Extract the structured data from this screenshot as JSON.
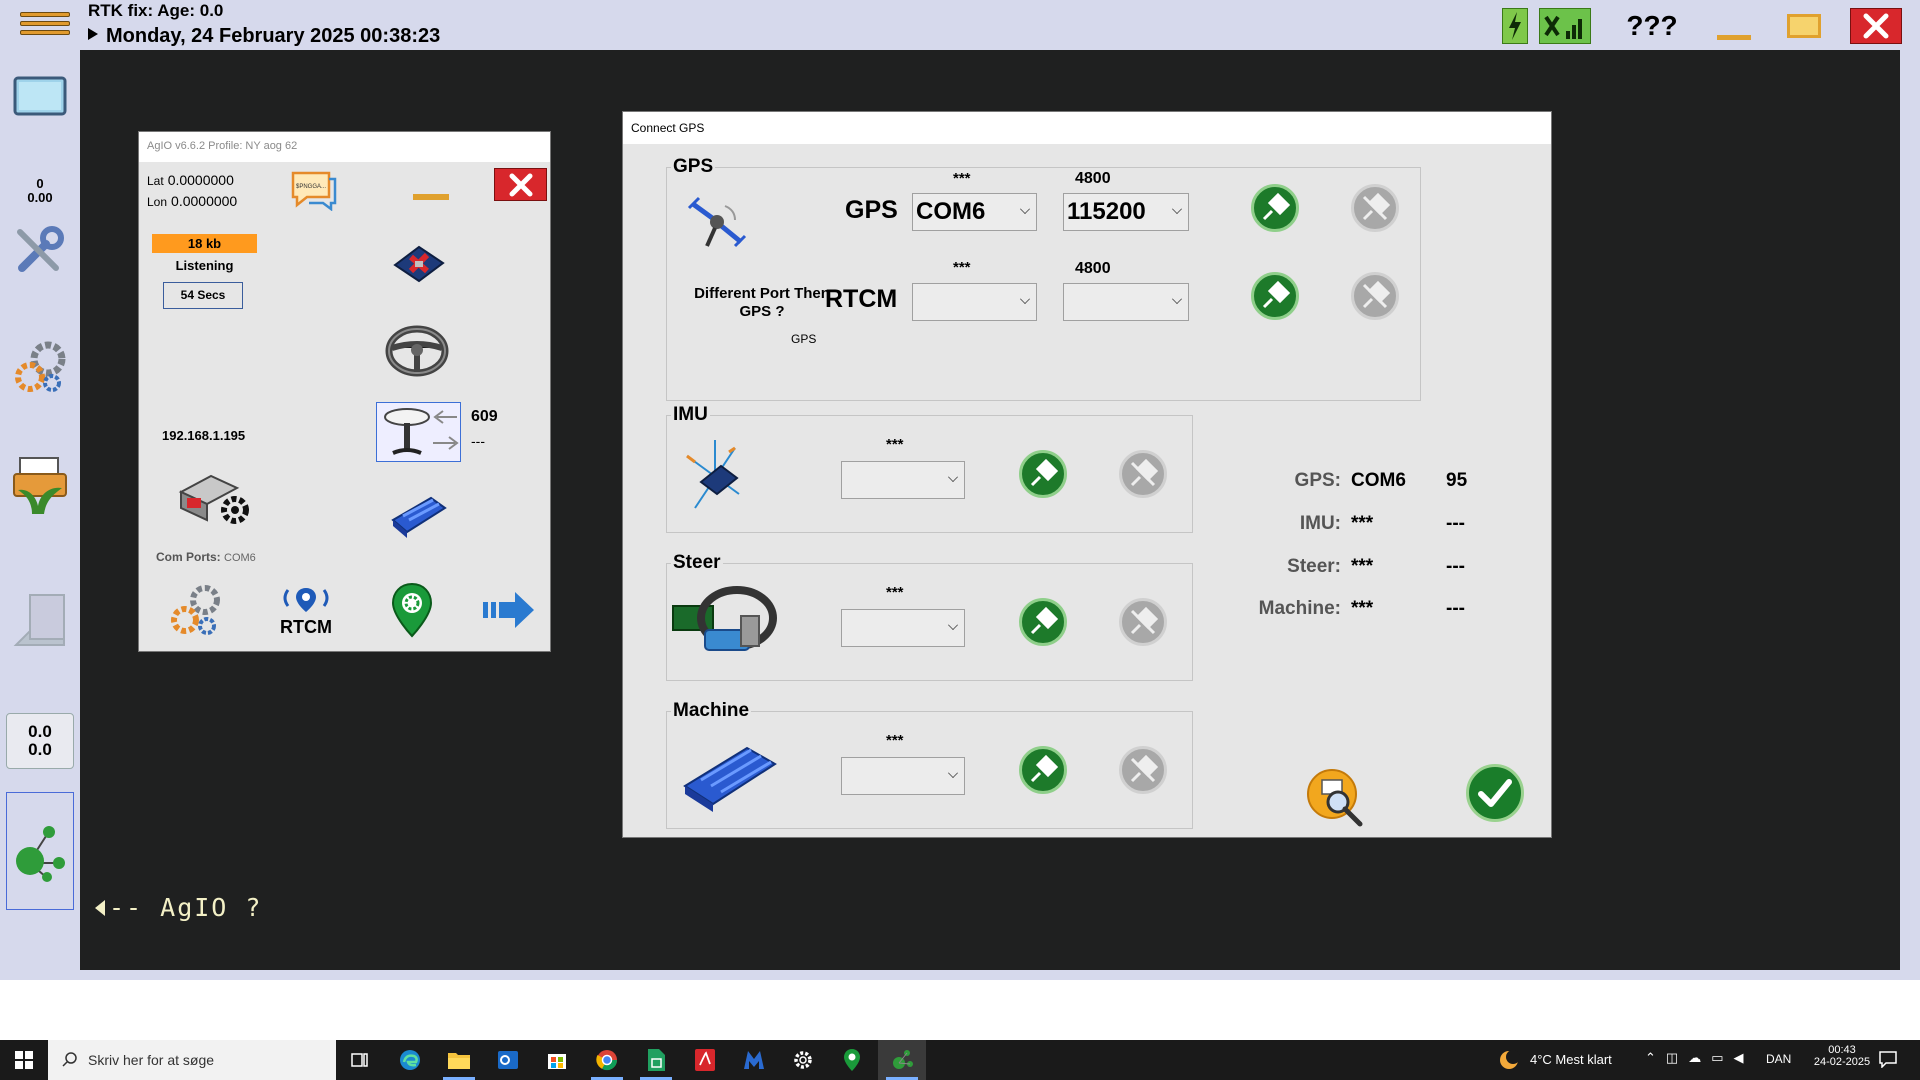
{
  "topbar": {
    "rtk_status": "RTK fix: Age: 0.0",
    "datetime": "Monday, 24 February 2025 00:38:23",
    "unknown_label": "???"
  },
  "sidebar": {
    "zero_top": "0",
    "zero_bottom": "0.00",
    "speed_top": "0.0",
    "speed_bottom": "0.0"
  },
  "main": {
    "agio_hint": "-- AgIO  ?"
  },
  "agio": {
    "title": "AgIO  v6.6.2 Profile: NY aog 62",
    "lat_label": "Lat",
    "lat_value": "0.0000000",
    "lon_label": "Lon",
    "lon_value": "0.0000000",
    "ntrip_chat_text": "$PNGGA...",
    "data_size": "18 kb",
    "status": "Listening",
    "seconds": "54 Secs",
    "gps_count": "609",
    "gps_dash": "---",
    "ip": "192.168.1.195",
    "com_ports_label": "Com Ports:",
    "com_ports_value": "COM6",
    "rtcm_label": "RTCM"
  },
  "connect_gps": {
    "title": "Connect GPS",
    "gps_group": {
      "title": "GPS",
      "port_label": "GPS",
      "port_stars": "***",
      "port_value": "COM6",
      "baud_label": "4800",
      "baud_value": "115200",
      "rtcm_question": "Different Port Then GPS ?",
      "rtcm_port_label": "RTCM",
      "rtcm_stars": "***",
      "rtcm_baud_label": "4800",
      "rtcm_small_label": "GPS"
    },
    "imu_group": {
      "title": "IMU",
      "stars": "***"
    },
    "steer_group": {
      "title": "Steer",
      "stars": "***"
    },
    "machine_group": {
      "title": "Machine",
      "stars": "***"
    },
    "summary": {
      "gps_label": "GPS:",
      "gps_port": "COM6",
      "gps_num": "95",
      "imu_label": "IMU:",
      "imu_port": "***",
      "imu_num": "---",
      "steer_label": "Steer:",
      "steer_port": "***",
      "steer_num": "---",
      "machine_label": "Machine:",
      "machine_port": "***",
      "machine_num": "---"
    }
  },
  "taskbar": {
    "search_placeholder": "Skriv her for at søge",
    "weather": "4°C  Mest klart",
    "lang": "DAN",
    "time": "00:43",
    "date": "24-02-2025"
  },
  "colors": {
    "app_bg": "#d6d9ec",
    "main_bg": "#1f2020",
    "accent_orange": "#ff9a1e",
    "connect_green": "#1d7a2a",
    "close_red": "#d8272c"
  }
}
